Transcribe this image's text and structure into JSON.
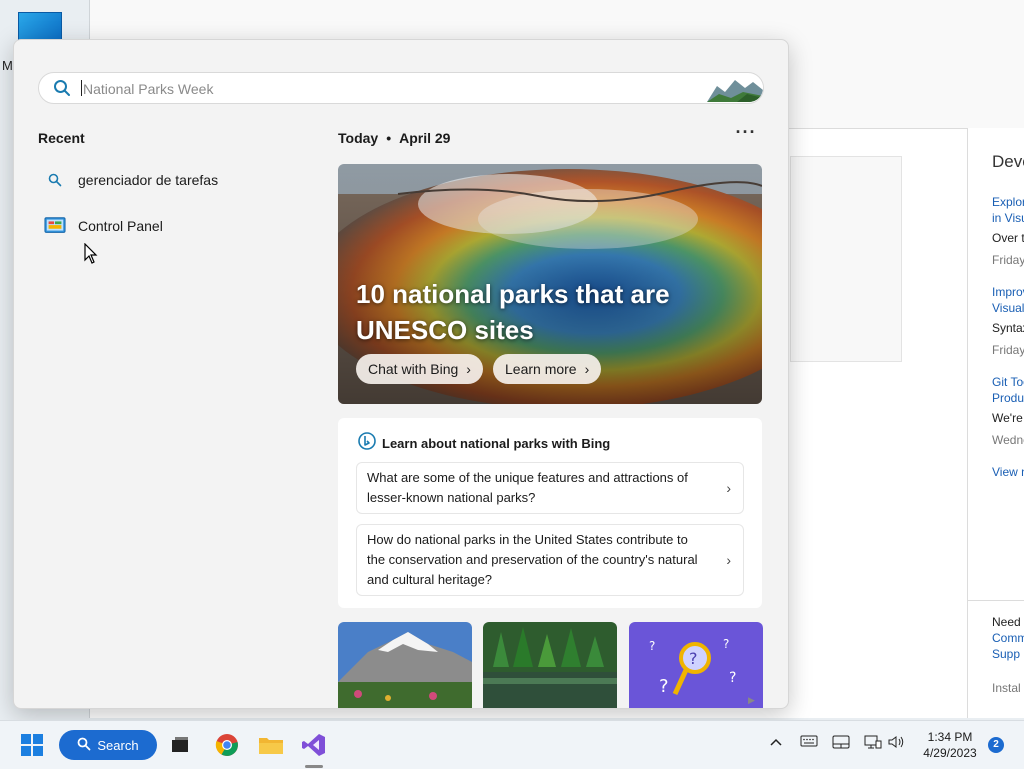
{
  "desktop": {
    "icon_label_fragment": "M"
  },
  "background_app": {
    "dev_panel": {
      "title": "Deve",
      "items": [
        {
          "link_line1": "Explor",
          "link_line2": "in Visu",
          "desc": "Over t",
          "date": "Friday,"
        },
        {
          "link_line1": "Improv",
          "link_line2": "Visual",
          "desc": "Syntax",
          "date": "Friday,"
        },
        {
          "link_line1": "Git Too",
          "link_line2": "Produc",
          "desc": "We're",
          "date": "Wedne"
        }
      ],
      "view_more": "View n",
      "bottom": {
        "need": "Need",
        "link1": "Comm",
        "link2": "Supp",
        "install": "Instal"
      }
    }
  },
  "search": {
    "placeholder": "National Parks Week",
    "value": ""
  },
  "recent": {
    "title": "Recent",
    "items": [
      {
        "label": "gerenciador de tarefas",
        "icon": "search-icon"
      },
      {
        "label": "Control Panel",
        "icon": "control-panel-icon"
      }
    ]
  },
  "today": {
    "label": "Today",
    "separator": "•",
    "date": "April 29",
    "more": "···"
  },
  "hero": {
    "title": "10 national parks that are UNESCO sites",
    "buttons": [
      {
        "label": "Chat with Bing",
        "icon": "chevron-right-icon"
      },
      {
        "label": "Learn more",
        "icon": "chevron-right-icon"
      }
    ]
  },
  "bing_card": {
    "title": "Learn about national parks with Bing",
    "questions": [
      "What are some of the unique features and attractions of lesser-known national parks?",
      "How do national parks in the United States contribute to the conservation and preservation of the country's natural and cultural heritage?"
    ]
  },
  "taskbar": {
    "search_label": "Search",
    "time": "1:34 PM",
    "date": "4/29/2023",
    "notifications": "2"
  },
  "colors": {
    "accent": "#1c6bd0",
    "flyout_bg": "#f3f3f3",
    "link": "#1a5fb4"
  }
}
